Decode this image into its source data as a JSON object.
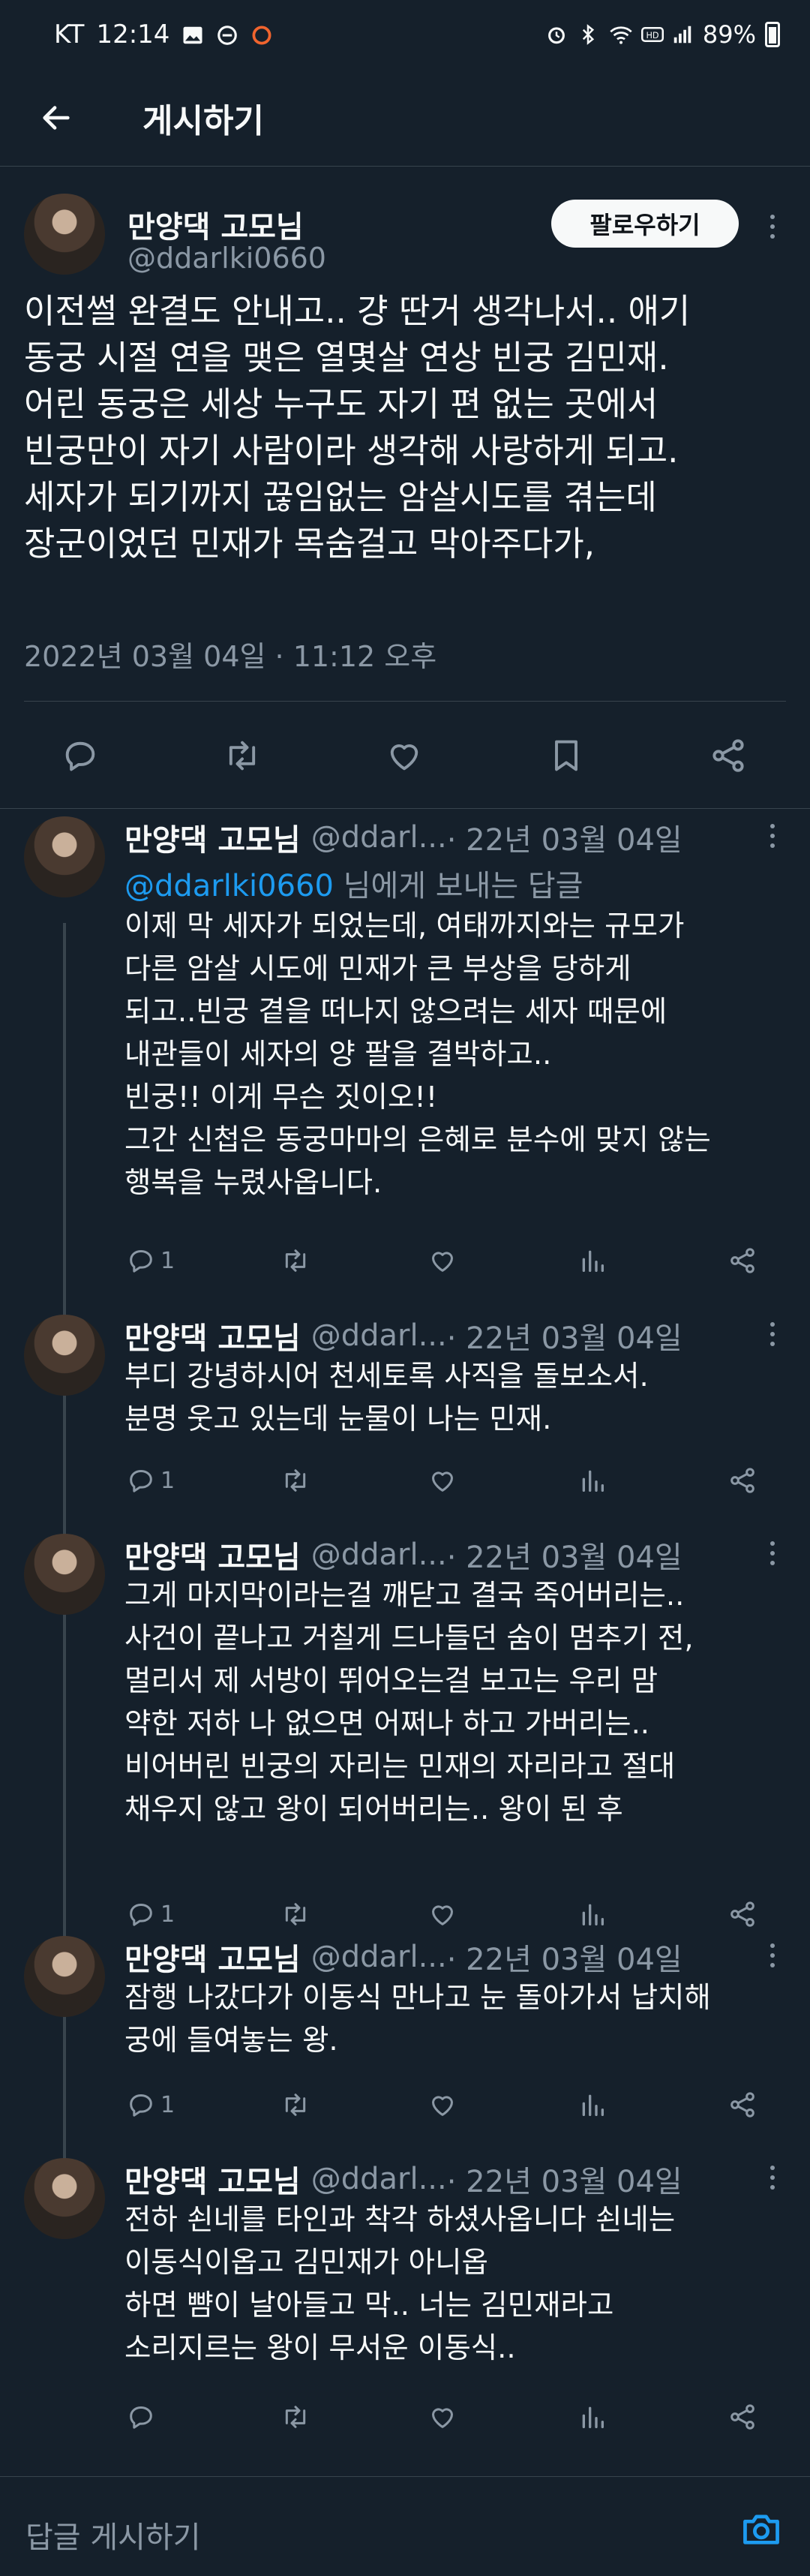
{
  "status_bar": {
    "carrier": "KT",
    "time": "12:14",
    "battery": "89%"
  },
  "header": {
    "title": "게시하기"
  },
  "main_tweet": {
    "author_name": "만양댁 고모님",
    "author_handle": "@ddarlki0660",
    "follow_label": "팔로우하기",
    "text": "이전썰 완결도 안내고.. 걍 딴거 생각나서.. 애기\n동궁 시절 연을 맺은 열몇살 연상 빈궁 김민재.\n어린 동궁은 세상 누구도 자기 편 없는 곳에서\n빈궁만이 자기 사람이라 생각해 사랑하게 되고.\n세자가 되기까지 끊임없는 암살시도를 겪는데\n장군이었던 민재가 목숨걸고 막아주다가,",
    "timestamp": "2022년 03월 04일 · 11:12 오후"
  },
  "replies": [
    {
      "name": "만양댁 고모님",
      "handle": "@ddarl...",
      "date": "· 22년 03월 04일",
      "reply_to_handle": "@ddarlki0660",
      "reply_to_suffix": " 님에게 보내는 답글",
      "text": "이제 막 세자가 되었는데, 여태까지와는 규모가\n다른 암살 시도에 민재가 큰 부상을 당하게\n되고..빈궁 곁을 떠나지 않으려는 세자 때문에\n내관들이 세자의 양 팔을 결박하고..\n빈궁!! 이게 무슨 짓이오!!\n그간 신첩은 동궁마마의 은혜로 분수에 맞지 않는\n행복을 누렸사옵니다.",
      "reply_count": "1"
    },
    {
      "name": "만양댁 고모님",
      "handle": "@ddarl...",
      "date": "· 22년 03월 04일",
      "text": "부디 강녕하시어 천세토록 사직을 돌보소서.\n분명 웃고 있는데 눈물이 나는 민재.",
      "reply_count": "1"
    },
    {
      "name": "만양댁 고모님",
      "handle": "@ddarl...",
      "date": "· 22년 03월 04일",
      "text": "그게 마지막이라는걸 깨닫고 결국 죽어버리는..\n사건이 끝나고 거칠게 드나들던 숨이 멈추기 전,\n멀리서 제 서방이 뛰어오는걸 보고는 우리 맘\n약한 저하 나 없으면 어쩌나 하고 가버리는..\n비어버린 빈궁의 자리는 민재의 자리라고 절대\n채우지 않고 왕이 되어버리는.. 왕이 된 후",
      "reply_count": "1"
    },
    {
      "name": "만양댁 고모님",
      "handle": "@ddarl...",
      "date": "· 22년 03월 04일",
      "text": "잠행 나갔다가 이동식 만나고 눈 돌아가서 납치해\n궁에 들여놓는 왕.",
      "reply_count": "1"
    },
    {
      "name": "만양댁 고모님",
      "handle": "@ddarl...",
      "date": "· 22년 03월 04일",
      "text": "전하 쇤네를 타인과 착각 하셨사옵니다 쇤네는\n이동식이옵고 김민재가 아니옵\n하면 뺨이 날아들고 막.. 너는 김민재라고\n소리지르는 왕이 무서운 이동식..",
      "reply_count": ""
    }
  ],
  "compose": {
    "placeholder": "답글 게시하기"
  },
  "icons": {
    "reply": "reply-icon",
    "retweet": "retweet-icon",
    "like": "like-icon",
    "bookmark": "bookmark-icon",
    "share": "share-icon",
    "views": "views-icon",
    "camera": "camera-icon"
  },
  "colors": {
    "background": "#15202b",
    "accent": "#1d9bf0",
    "text": "#f7f9f9",
    "secondary": "#8b98a5"
  }
}
